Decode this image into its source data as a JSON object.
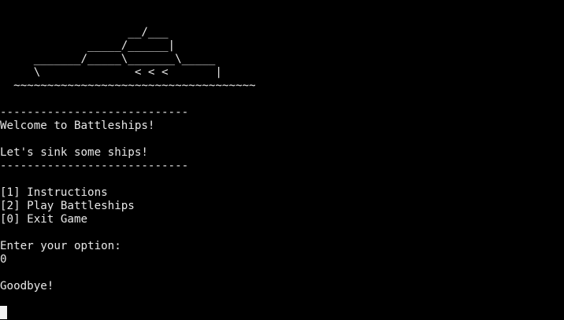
{
  "art": {
    "line1": "                   __/___",
    "line2": "             _____/______|",
    "line3": "     _______/_____\\_______\\_____",
    "line4": "     \\              < < <       |",
    "line5": "  ~~~~~~~~~~~~~~~~~~~~~~~~~~~~~~~~~~~~"
  },
  "divider_top": "----------------------------",
  "welcome": "Welcome to Battleships!",
  "tagline": "Let's sink some ships!",
  "divider_bottom": "----------------------------",
  "menu": [
    {
      "label": "[1] Instructions"
    },
    {
      "label": "[2] Play Battleships"
    },
    {
      "label": "[0] Exit Game"
    }
  ],
  "prompt": "Enter your option:",
  "user_input": "0",
  "goodbye": "Goodbye!"
}
